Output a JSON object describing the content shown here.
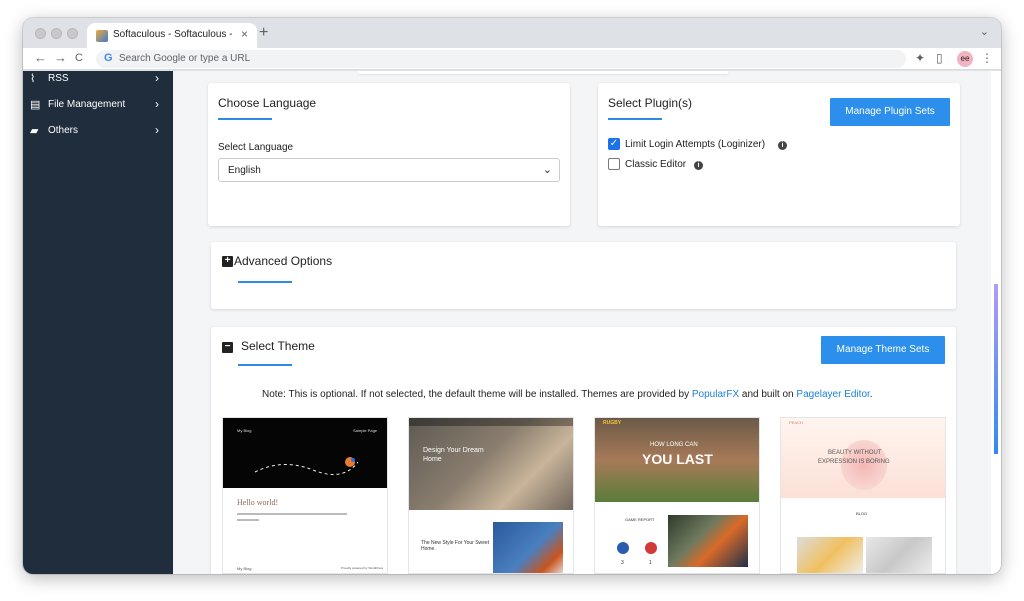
{
  "browser": {
    "tab_title": "Softaculous - Softaculous - W",
    "tab_close": "×",
    "new_tab": "+",
    "tab_menu": "⌄",
    "back": "←",
    "forward": "→",
    "reload": "C",
    "google_glyph": "G",
    "omnibox_placeholder": "Search Google or type a URL",
    "avatar_text": "ee"
  },
  "sidebar": {
    "items": [
      {
        "label": "RSS",
        "icon": "rss-icon",
        "glyph": "⌇",
        "chevron": "›"
      },
      {
        "label": "File Management",
        "icon": "file-icon",
        "glyph": "▤",
        "chevron": "›"
      },
      {
        "label": "Others",
        "icon": "folder-icon",
        "glyph": "▰",
        "chevron": "›"
      }
    ]
  },
  "language_card": {
    "title": "Choose Language",
    "select_label": "Select Language",
    "selected": "English",
    "arrow": "⌄"
  },
  "plugins_card": {
    "title": "Select Plugin(s)",
    "manage_button": "Manage Plugin Sets",
    "plugins": [
      {
        "label": "Limit Login Attempts (Loginizer)",
        "checked": true
      },
      {
        "label": "Classic Editor",
        "checked": false
      }
    ],
    "check_glyph": "✓",
    "info_glyph": "i"
  },
  "advanced": {
    "title": "Advanced Options",
    "toggle_glyph": "+"
  },
  "theme": {
    "title": "Select Theme",
    "toggle_glyph": "−",
    "manage_button": "Manage Theme Sets",
    "note_prefix": "Note: This is optional. If not selected, the default theme will be installed. Themes are provided by",
    "note_link1": "PopularFX",
    "note_middle": "and built on",
    "note_link2": "Pagelayer Editor",
    "note_suffix": ".",
    "thumb1": {
      "brand": "My Blog",
      "nav": "Sample Page",
      "heading": "Hello world!",
      "footer_left": "My Blog",
      "footer_right": "Proudly powered by WordPress"
    },
    "thumb2": {
      "heading": "Design Your Dream Home",
      "subheading": "The New Style For Your Sweet Home."
    },
    "thumb3": {
      "brand": "RUGBY",
      "heading_small": "HOW LONG CAN",
      "heading": "YOU LAST",
      "section": "GAME REPORT",
      "score_a": "3",
      "score_b": "1"
    },
    "thumb4": {
      "brand": "PEACH",
      "heading1": "BEAUTY WITHOUT",
      "heading2": "EXPRESSION IS BORING",
      "section": "BLOG"
    }
  },
  "colors": {
    "accent": "#2d8fec",
    "sidebar": "#1f2d3d",
    "link": "#1a7fd8"
  }
}
